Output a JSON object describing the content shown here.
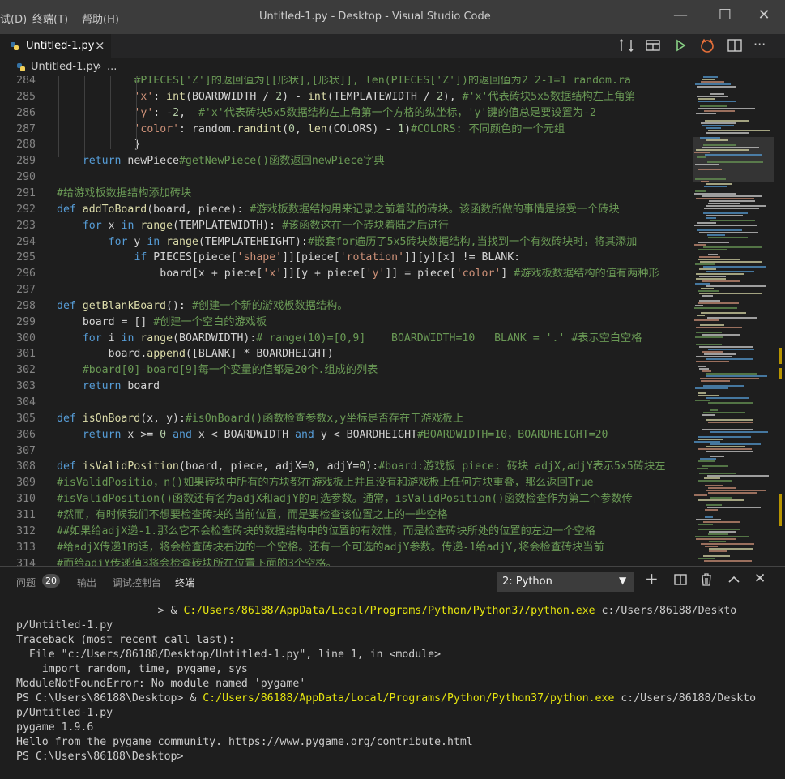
{
  "titlebar": {
    "menu": [
      "试(D)",
      "终端(T)",
      "帮助(H)"
    ],
    "title": "Untitled-1.py - Desktop - Visual Studio Code"
  },
  "tab": {
    "label": "Untitled-1.py",
    "close": "×"
  },
  "breadcrumb": {
    "file": "Untitled-1.py",
    "sep": "›",
    "rest": "..."
  },
  "editor": {
    "lines": [
      {
        "n": "284",
        "t": "            #PIECES['Z']的返回值为[[形状],[形状]], len(PIECES['Z'])的返回值为2 2-1=1 random.ra"
      },
      {
        "n": "285",
        "t": "            'x': int(BOARDWIDTH / 2) - int(TEMPLATEWIDTH / 2), #'x'代表砖块5x5数据结构左上角第"
      },
      {
        "n": "286",
        "t": "            'y': -2,  #'x'代表砖块5x5数据结构左上角第一个方格的纵坐标，'y'键的值总是要设置为-2"
      },
      {
        "n": "287",
        "t": "            'color': random.randint(0, len(COLORS) - 1)#COLORS: 不同颜色的一个元组"
      },
      {
        "n": "288",
        "t": "            }"
      },
      {
        "n": "289",
        "t": "    return newPiece#getNewPiece()函数返回newPiece字典"
      },
      {
        "n": "290",
        "t": ""
      },
      {
        "n": "291",
        "t": "#给游戏板数据结构添加砖块"
      },
      {
        "n": "292",
        "t": "def addToBoard(board, piece): #游戏板数据结构用来记录之前着陆的砖块。该函数所做的事情是接受一个砖块"
      },
      {
        "n": "293",
        "t": "    for x in range(TEMPLATEWIDTH): #该函数这在一个砖块着陆之后进行"
      },
      {
        "n": "294",
        "t": "        for y in range(TEMPLATEHEIGHT):#嵌套for遍历了5x5砖块数据结构,当找到一个有效砖块时，将其添加"
      },
      {
        "n": "295",
        "t": "            if PIECES[piece['shape']][piece['rotation']][y][x] != BLANK:"
      },
      {
        "n": "296",
        "t": "                board[x + piece['x']][y + piece['y']] = piece['color'] #游戏板数据结构的值有两种形"
      },
      {
        "n": "297",
        "t": ""
      },
      {
        "n": "298",
        "t": "def getBlankBoard(): #创建一个新的游戏板数据结构。"
      },
      {
        "n": "299",
        "t": "    board = [] #创建一个空白的游戏板"
      },
      {
        "n": "300",
        "t": "    for i in range(BOARDWIDTH):# range(10)=[0,9]    BOARDWIDTH=10   BLANK = '.' #表示空白空格"
      },
      {
        "n": "301",
        "t": "        board.append([BLANK] * BOARDHEIGHT)"
      },
      {
        "n": "302",
        "t": "    #board[0]-board[9]每一个变量的值都是20个.组成的列表"
      },
      {
        "n": "303",
        "t": "    return board"
      },
      {
        "n": "304",
        "t": ""
      },
      {
        "n": "305",
        "t": "def isOnBoard(x, y):#isOnBoard()函数检查参数x,y坐标是否存在于游戏板上"
      },
      {
        "n": "306",
        "t": "    return x >= 0 and x < BOARDWIDTH and y < BOARDHEIGHT#BOARDWIDTH=10，BOARDHEIGHT=20"
      },
      {
        "n": "307",
        "t": ""
      },
      {
        "n": "308",
        "t": "def isValidPosition(board, piece, adjX=0, adjY=0):#board:游戏板 piece: 砖块 adjX,adjY表示5x5砖块左"
      },
      {
        "n": "309",
        "t": "#isValidPositio，n()如果砖块中所有的方块都在游戏板上并且没有和游戏板上任何方块重叠，那么返回True"
      },
      {
        "n": "310",
        "t": "#isValidPosition()函数还有名为adjX和adjY的可选参数。通常，isValidPosition()函数检查作为第二个参数传"
      },
      {
        "n": "311",
        "t": "#然而，有时候我们不想要检查砖块的当前位置，而是要检查该位置之上的一些空格"
      },
      {
        "n": "312",
        "t": "##如果给adjX递-1.那么它不会检查砖块的数据结构中的位置的有效性，而是检查砖块所处的位置的左边一个空格"
      },
      {
        "n": "313",
        "t": "#给adjX传递1的话，将会检查砖块右边的一个空格。还有一个可选的adjY参数。传递-1给adjY,将会检查砖块当前"
      },
      {
        "n": "314",
        "t": "#而给adjY传递值3将会检查砖块所在位置下面的3个空格。"
      }
    ]
  },
  "panel": {
    "tabs": [
      "问题",
      "输出",
      "调试控制台",
      "终端"
    ],
    "problems_count": "20",
    "terminal_select": "2: Python",
    "terminal_lines": [
      "                      > & C:/Users/86188/AppData/Local/Programs/Python/Python37/python.exe c:/Users/86188/Deskto",
      "p/Untitled-1.py",
      "Traceback (most recent call last):",
      "  File \"c:/Users/86188/Desktop/Untitled-1.py\", line 1, in <module>",
      "    import random, time, pygame, sys",
      "ModuleNotFoundError: No module named 'pygame'",
      "PS C:\\Users\\86188\\Desktop> & C:/Users/86188/AppData/Local/Programs/Python/Python37/python.exe c:/Users/86188/Deskto",
      "p/Untitled-1.py",
      "pygame 1.9.6",
      "Hello from the pygame community. https://www.pygame.org/contribute.html",
      "PS C:\\Users\\86188\\Desktop>"
    ]
  },
  "colors": {
    "titlebar": "#3c3c3c",
    "editor_bg": "#1e1e1e",
    "keyword": "#569cd6",
    "function": "#dcdcaa",
    "string": "#ce9178",
    "comment": "#6a9955",
    "terminal_path": "#e5e510"
  }
}
